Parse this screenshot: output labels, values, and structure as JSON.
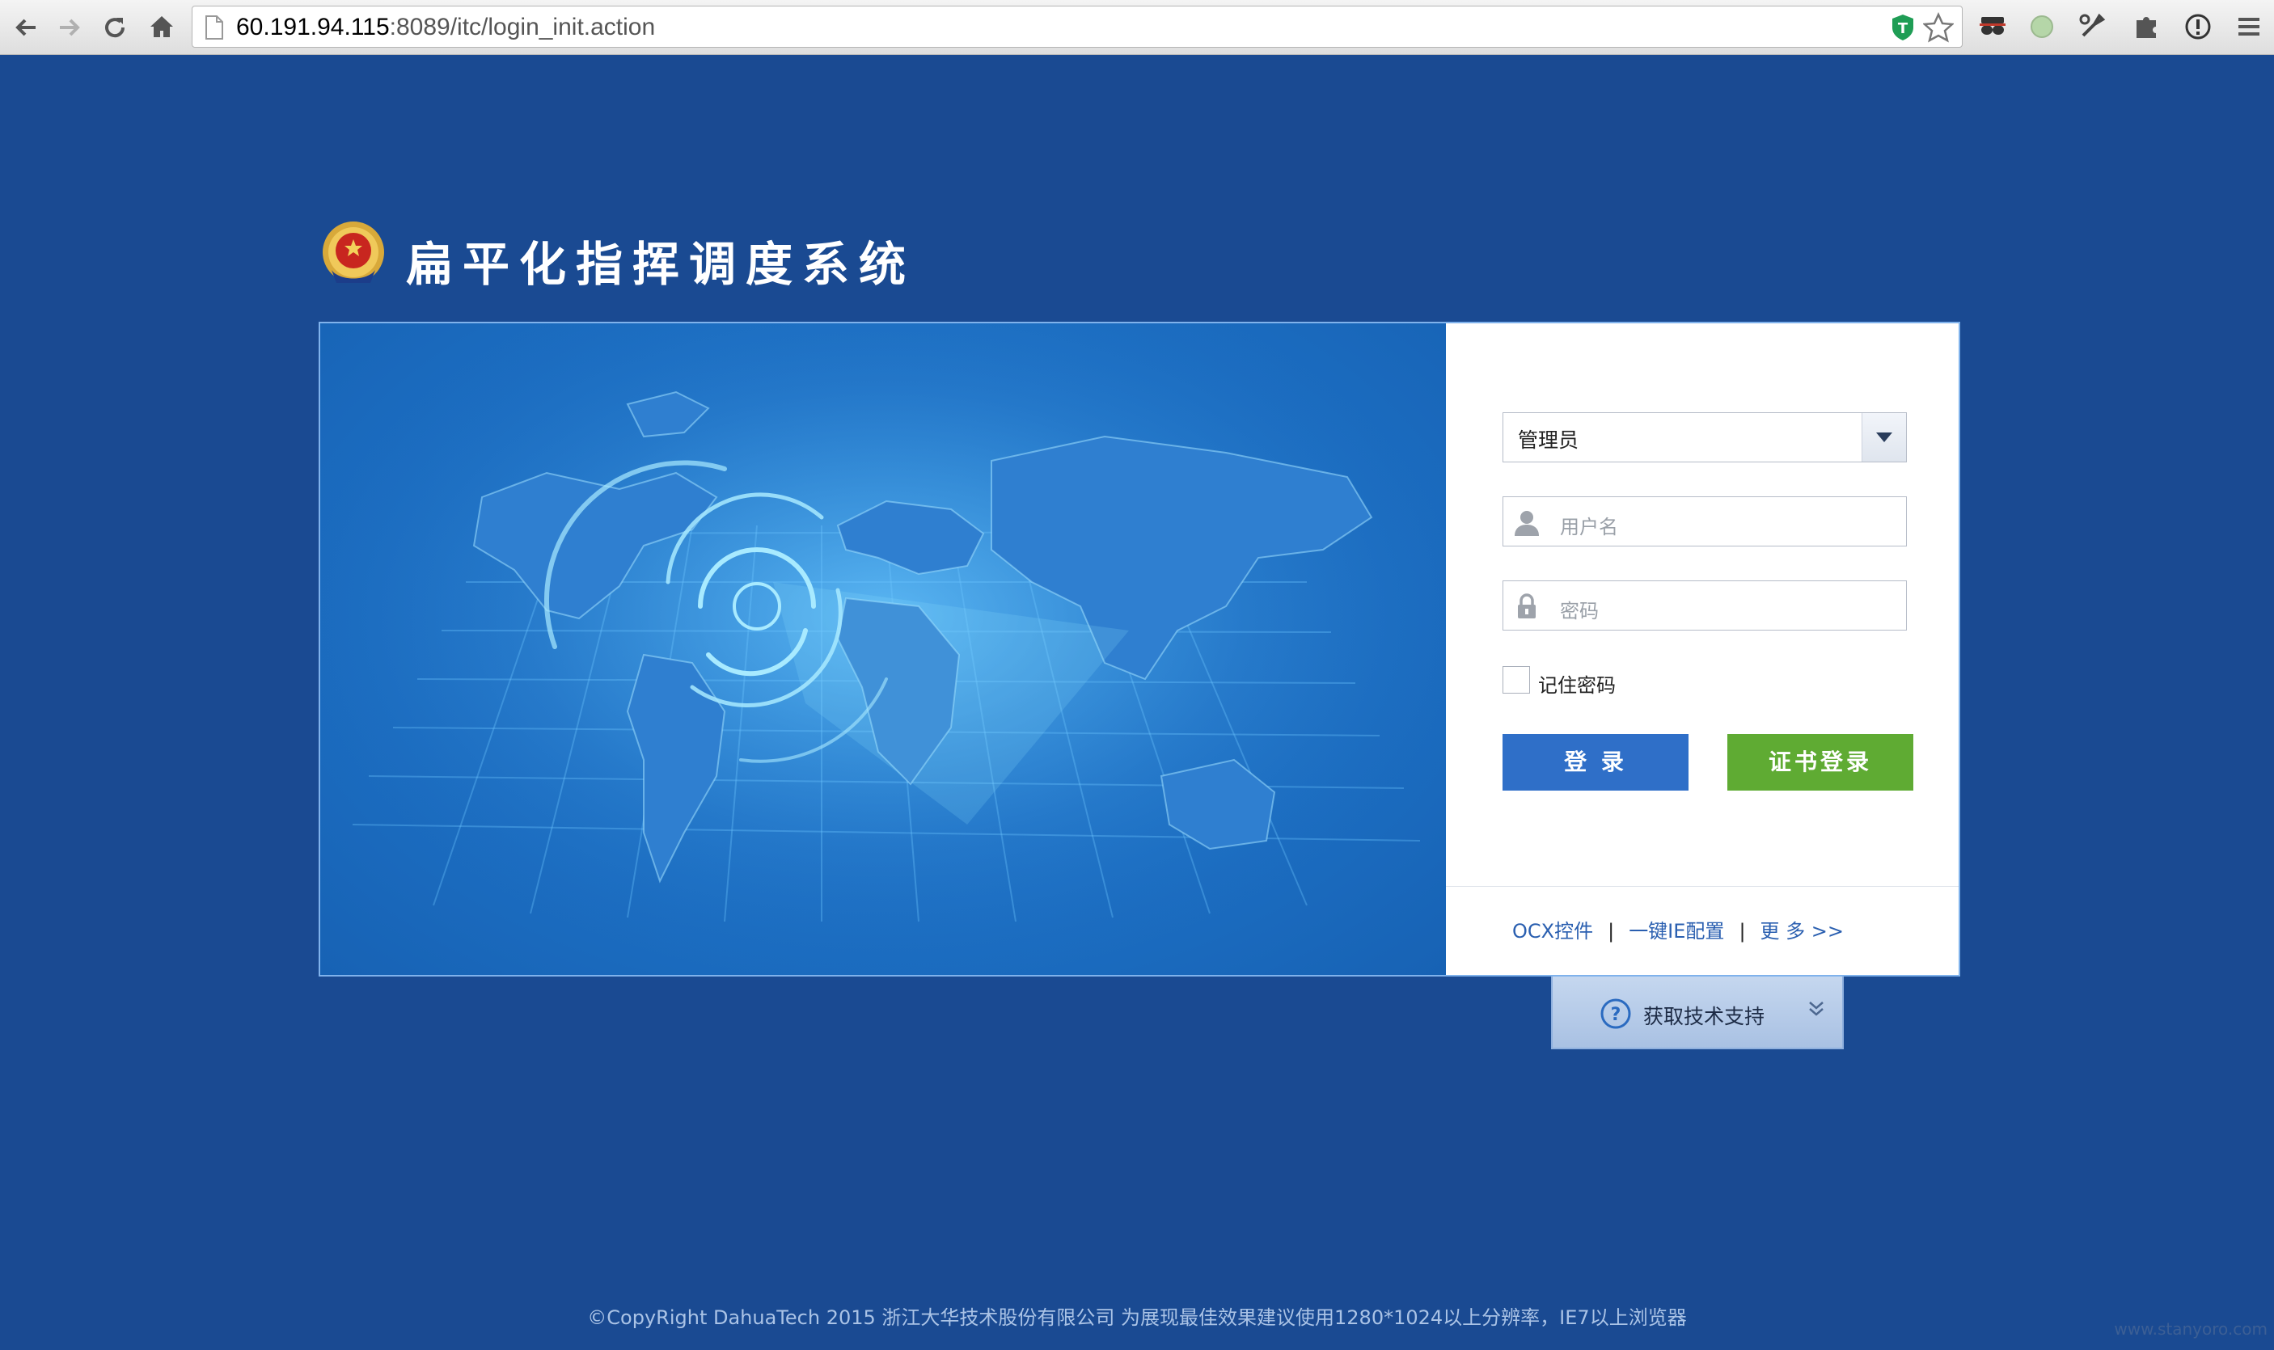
{
  "browser": {
    "url_host": "60.191.94.115",
    "url_path": ":8089/itc/login_init.action"
  },
  "page": {
    "title": "扁平化指挥调度系统"
  },
  "login": {
    "role_select_value": "管理员",
    "username_placeholder": "用户名",
    "password_placeholder": "密码",
    "remember_label": "记住密码",
    "login_button": "登 录",
    "cert_login_button": "证书登录"
  },
  "links": {
    "ocx": "OCX控件",
    "ie_config": "一键IE配置",
    "more": "更 多 >>",
    "separator": "|"
  },
  "support": {
    "label": "获取技术支持"
  },
  "footer": {
    "text": "©CopyRight DahuaTech 2015 浙江大华技术股份有限公司 为展现最佳效果建议使用1280*1024以上分辨率，IE7以上浏览器"
  },
  "watermark": "www.stanyoro.com",
  "colors": {
    "page_bg": "#1a4a92",
    "login_button": "#2f6fc8",
    "cert_button": "#5fab33",
    "link": "#2a5fb0"
  }
}
